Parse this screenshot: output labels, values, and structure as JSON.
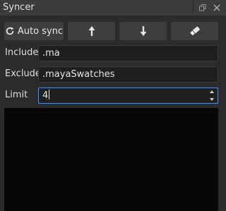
{
  "window": {
    "title": "Syncer"
  },
  "toolbar": {
    "auto_sync_label": "Auto sync",
    "auto_sync_icon": "refresh-icon",
    "up_icon": "arrow-up-icon",
    "down_icon": "arrow-down-icon",
    "eraser_icon": "eraser-icon"
  },
  "form": {
    "include": {
      "label": "Include",
      "value": ".ma"
    },
    "exclude": {
      "label": "Exclude",
      "value": ".mayaSwatches"
    },
    "limit": {
      "label": "Limit",
      "value": "4"
    }
  },
  "log": {
    "content": ""
  },
  "colors": {
    "window_bg": "#2b2b2b",
    "titlebar_bg": "#3c3c3c",
    "button_bg": "#3e3e3e",
    "field_bg": "#1f1f1f",
    "focus_border": "#5b8fd0",
    "log_bg": "#080808"
  }
}
